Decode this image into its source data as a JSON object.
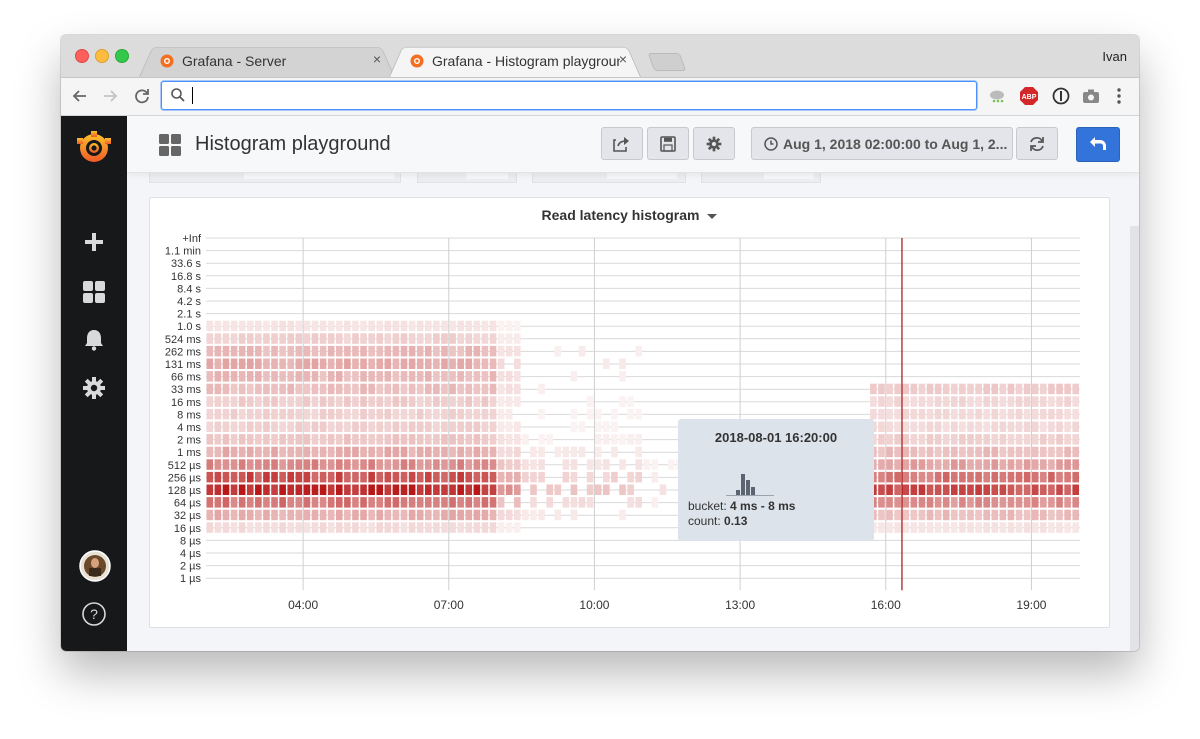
{
  "browser": {
    "tabs": [
      {
        "title": "Grafana - Server",
        "active": false,
        "close": "×"
      },
      {
        "title": "Grafana - Histogram playground",
        "active": true,
        "close": "×"
      }
    ],
    "profile_name": "Ivan",
    "address_value": ""
  },
  "sidemenu": {
    "items": [
      "grafana-logo-icon",
      "plus-icon",
      "dashboards-icon",
      "bell-icon",
      "gear-icon",
      "avatar",
      "help-icon"
    ]
  },
  "dashboard": {
    "title": "Histogram playground",
    "time_range": "Aug 1, 2018 02:00:00 to Aug 1, 2...",
    "buttons": [
      "share-icon",
      "save-icon",
      "settings-icon",
      "refresh-icon",
      "back-icon"
    ]
  },
  "colors": {
    "accent": "#3274d9",
    "heat_dark": "#b81818",
    "marker": "#a01010",
    "sidemenu": "#171819"
  },
  "panel": {
    "title": "Read latency histogram",
    "tooltip": {
      "time": "2018-08-01 16:20:00",
      "bucket_label": "bucket:",
      "bucket_value": "4 ms - 8 ms",
      "count_label": "count:",
      "count_value": "0.13"
    }
  },
  "chart_data": {
    "type": "heatmap",
    "title": "Read latency histogram",
    "y_buckets": [
      "+Inf",
      "1.1 min",
      "33.6 s",
      "16.8 s",
      "8.4 s",
      "4.2 s",
      "2.1 s",
      "1.0 s",
      "524 ms",
      "262 ms",
      "131 ms",
      "66 ms",
      "33 ms",
      "16 ms",
      "8 ms",
      "4 ms",
      "2 ms",
      "1 ms",
      "512 µs",
      "256 µs",
      "128 µs",
      "64 µs",
      "32 µs",
      "16 µs",
      "8 µs",
      "4 µs",
      "2 µs",
      "1 µs"
    ],
    "x_ticks": [
      "04:00",
      "07:00",
      "10:00",
      "13:00",
      "16:00",
      "19:00"
    ],
    "x_range": [
      "02:00",
      "20:00"
    ],
    "marker_time": "16:20",
    "grid": true,
    "intensity_by_bucket": {
      "1.0 s": 0.12,
      "524 ms": 0.2,
      "262 ms": 0.3,
      "131 ms": 0.35,
      "66 ms": 0.3,
      "33 ms": 0.28,
      "16 ms": 0.22,
      "8 ms": 0.2,
      "4 ms": 0.2,
      "2 ms": 0.25,
      "1 ms": 0.35,
      "512 µs": 0.5,
      "256 µs": 0.75,
      "128 µs": 0.95,
      "64 µs": 0.6,
      "32 µs": 0.35,
      "16 µs": 0.15
    }
  }
}
